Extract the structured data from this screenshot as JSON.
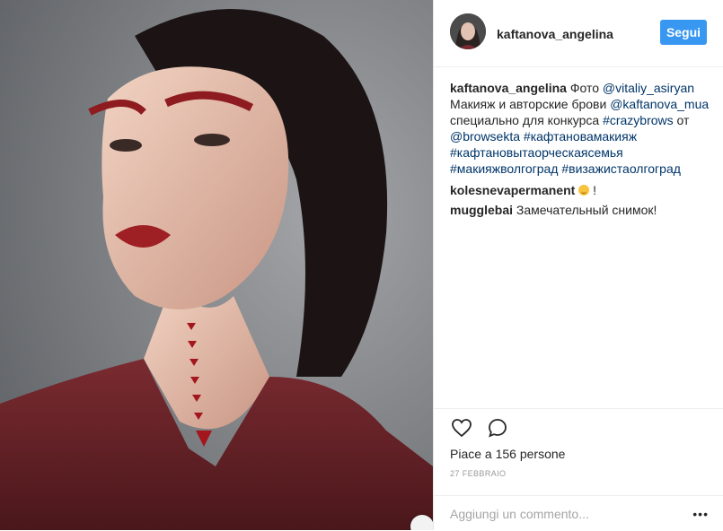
{
  "post": {
    "username": "kaftanova_angelina",
    "follow_label": "Segui",
    "caption": {
      "user": "kaftanova_angelina",
      "text_1": " Фото ",
      "mention_1": "@vitaliy_asiryan",
      "text_2": " Макияж и авторские брови ",
      "mention_2": "@kaftanova_mua",
      "text_3": " специально для конкурса ",
      "tag_1": "#crazybrows",
      "text_4": " от ",
      "mention_3": "@browsekta",
      "tag_2": "#кафтановамакияж",
      "tag_3": "#кафтановытаорческаясемья",
      "tag_4": "#макияжволгоград",
      "tag_5": "#визажистаолгоград"
    },
    "comments": [
      {
        "user": "kolesnevapermanent",
        "text": " !"
      },
      {
        "user": "mugglebai",
        "text": " Замечательный снимок!"
      }
    ],
    "likes": "Piace a 156 persone",
    "date": "27 FEBBRAIO",
    "add_comment_placeholder": "Aggiungi un commento...",
    "more_label": "•••"
  },
  "colors": {
    "accent": "#3897f0",
    "link": "#003569",
    "lipstick": "#9e1f24",
    "background": "#7c7f84"
  }
}
